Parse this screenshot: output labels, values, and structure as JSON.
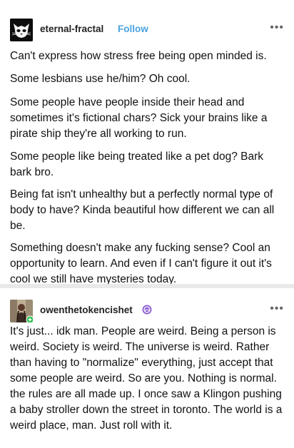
{
  "posts": [
    {
      "username": "eternal-fractal",
      "follow_label": "Follow",
      "more_label": "•••",
      "paragraphs": [
        "Can't express how stress free being open minded is.",
        "Some lesbians use he/him? Oh cool.",
        "Some people have people inside their head and sometimes it's fictional chars? Sick your brains like a pirate ship they're all working to run.",
        "Some people like being treated like a pet dog? Bark bark bro.",
        "Being fat isn't unhealthy but a perfectly normal type of body to have? Kinda beautiful how different we can all be.",
        "Something doesn't make any fucking sense? Cool an opportunity to learn. And even if I can't figure it out it's cool we still have mysteries today."
      ]
    },
    {
      "username": "owenthetokencishet",
      "more_label": "•••",
      "paragraphs": [
        "It's just... idk man. People are weird. Being a person is weird. Society is weird. The universe is weird. Rather than having to \"normalize\" everything, just accept that some people are weird. So are you. Nothing is normal. the rules are all made up. I once saw a Klingon pushing a baby stroller down the street in toronto. The world is a weird place, man. Just roll with it."
      ]
    }
  ],
  "colors": {
    "follow": "#4aa3df",
    "badge": "#8e5fd6",
    "online": "#2fbf4f",
    "divider": "#e9e9e9"
  }
}
